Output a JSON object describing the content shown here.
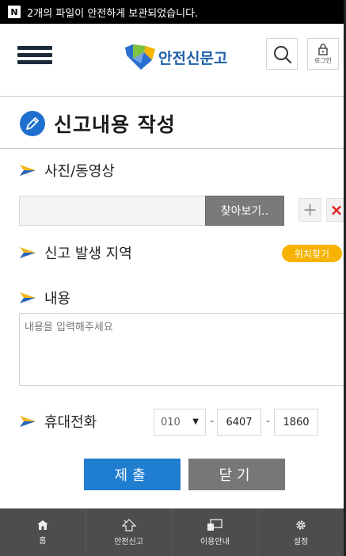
{
  "status_bar": {
    "badge": "N",
    "message": "2개의 파일이 안전하게 보관되었습니다."
  },
  "header": {
    "logo_text": "안전신문고",
    "login_label": "로그인",
    "icons": {
      "menu": "hamburger-menu-icon",
      "search": "search-icon",
      "login": "lock-icon"
    }
  },
  "page": {
    "title": "신고내용 작성"
  },
  "sections": {
    "photo_label": "사진/동영상",
    "browse_button": "찾아보기..",
    "add_symbol": "+",
    "remove_symbol": "×",
    "location_label": "신고 발생 지역",
    "locate_button": "위치찾기",
    "content_label": "내용",
    "content_placeholder": "내용을 입력해주세요",
    "phone_label": "휴대전화",
    "phone_prefix": "010",
    "phone_middle": "6407",
    "phone_last": "1860"
  },
  "actions": {
    "submit": "제출",
    "close": "닫기"
  },
  "bottom_nav": {
    "items": [
      {
        "label": "홈",
        "icon": "home-icon"
      },
      {
        "label": "안전신고",
        "icon": "report-icon"
      },
      {
        "label": "이용안내",
        "icon": "guide-icon"
      },
      {
        "label": "설정",
        "icon": "gear-icon"
      }
    ]
  },
  "colors": {
    "status_bar": "#000000",
    "accent_blue": "#1f7ed0",
    "locate_orange": "#f6b300",
    "close_gray": "#777777",
    "bottom_nav": "#4d4d4d",
    "remove_red": "#e02020"
  }
}
